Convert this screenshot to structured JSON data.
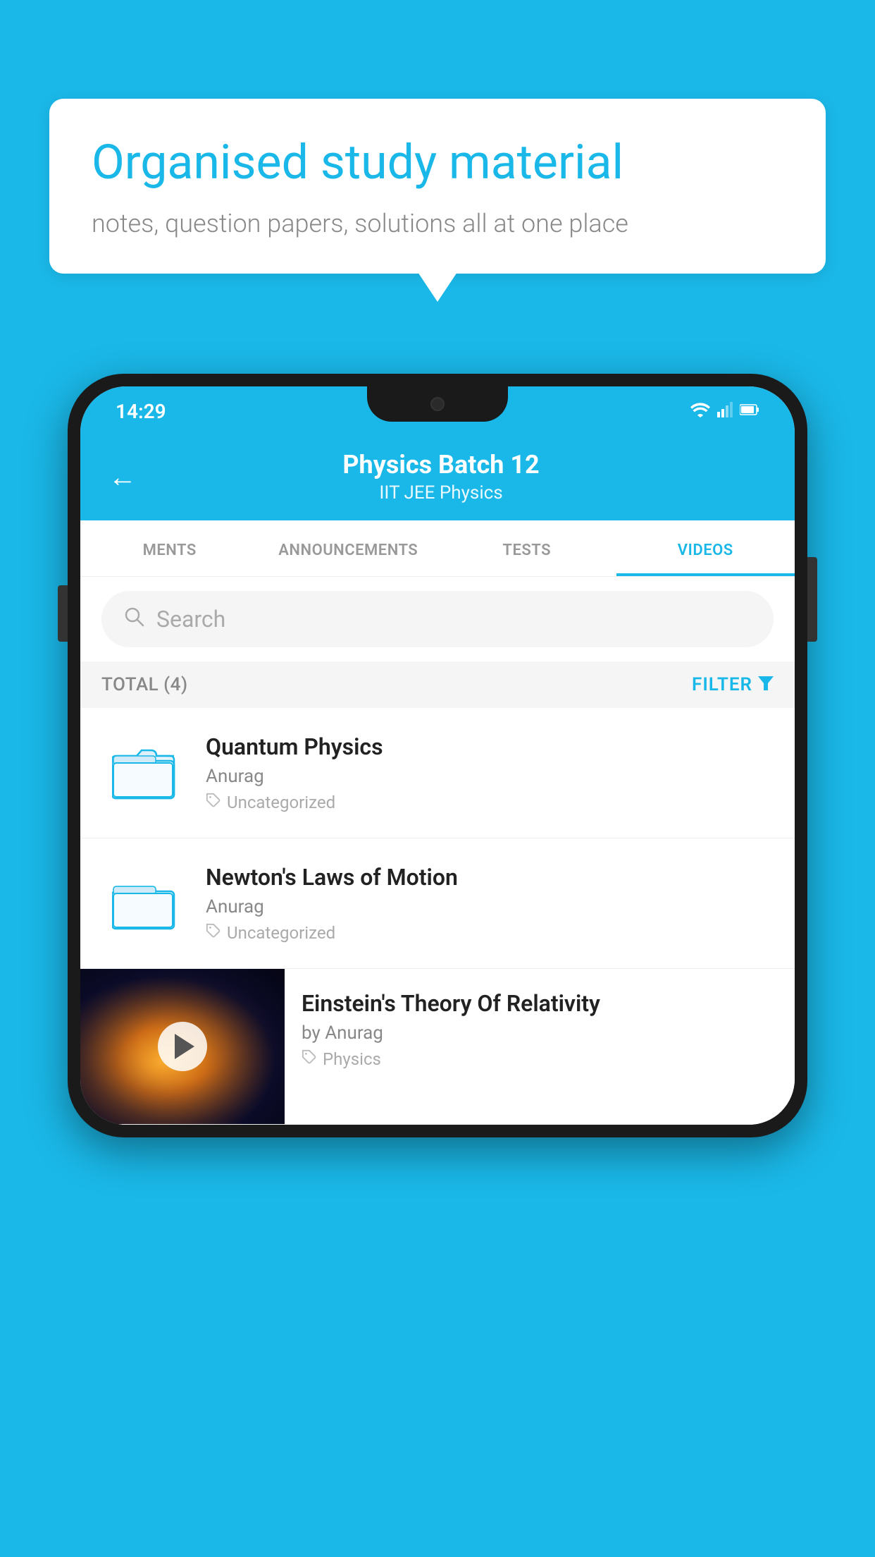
{
  "background_color": "#1ab8e8",
  "speech_bubble": {
    "heading": "Organised study material",
    "subtext": "notes, question papers, solutions all at one place"
  },
  "status_bar": {
    "time": "14:29",
    "wifi": "▼",
    "signal": "▲",
    "battery": "▮"
  },
  "header": {
    "title": "Physics Batch 12",
    "subtitle": "IIT JEE   Physics",
    "back_label": "←"
  },
  "tabs": [
    {
      "label": "MENTS",
      "active": false
    },
    {
      "label": "ANNOUNCEMENTS",
      "active": false
    },
    {
      "label": "TESTS",
      "active": false
    },
    {
      "label": "VIDEOS",
      "active": true
    }
  ],
  "search": {
    "placeholder": "Search"
  },
  "filter_row": {
    "total_label": "TOTAL (4)",
    "filter_label": "FILTER"
  },
  "video_items": [
    {
      "title": "Quantum Physics",
      "author": "Anurag",
      "tag": "Uncategorized",
      "has_thumb": false
    },
    {
      "title": "Newton's Laws of Motion",
      "author": "Anurag",
      "tag": "Uncategorized",
      "has_thumb": false
    },
    {
      "title": "Einstein's Theory Of Relativity",
      "author": "by Anurag",
      "tag": "Physics",
      "has_thumb": true
    }
  ]
}
